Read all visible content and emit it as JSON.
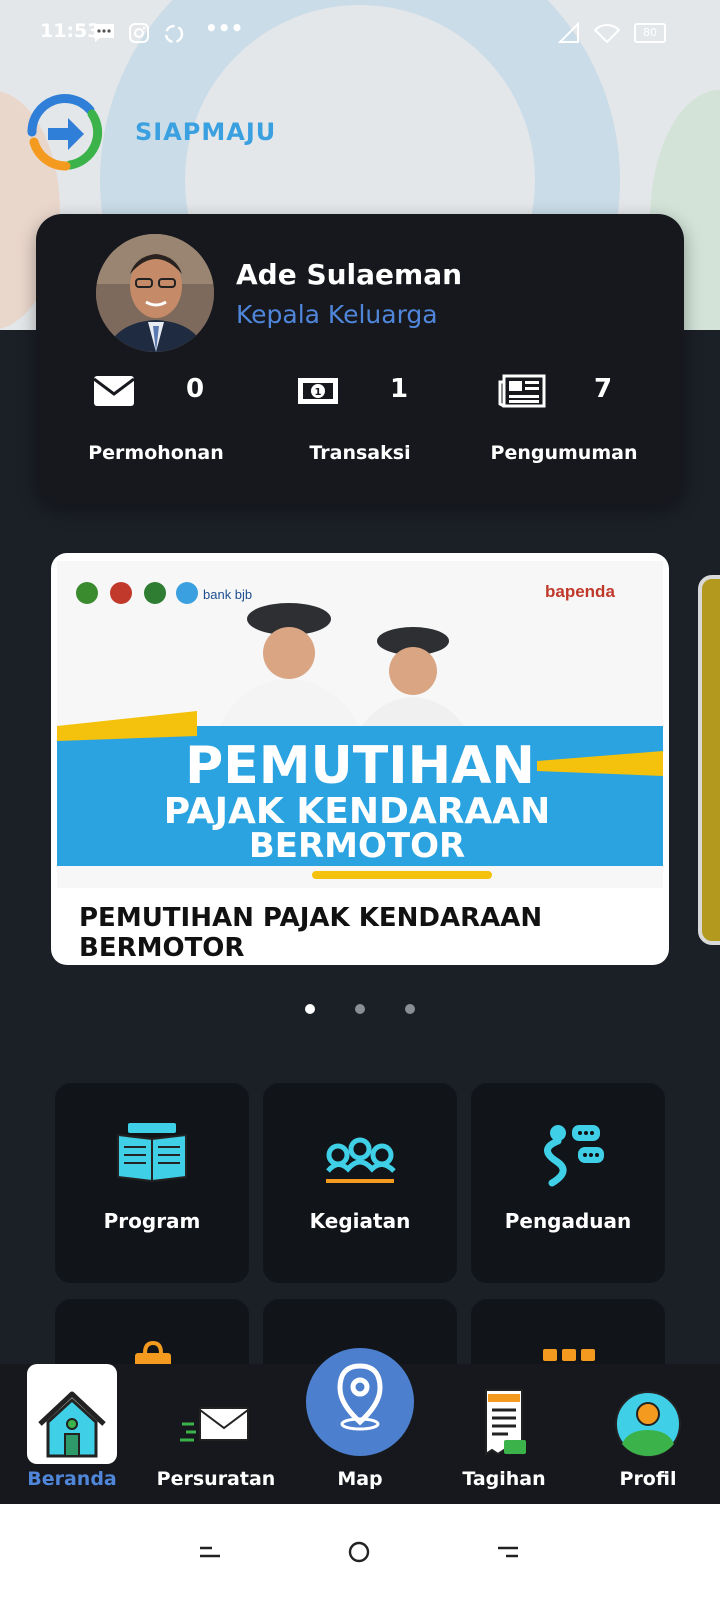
{
  "status_bar": {
    "time": "11:53",
    "more": "•••",
    "battery": "80"
  },
  "app": {
    "brand": "SIAPMAJU"
  },
  "profile": {
    "name": "Ade Sulaeman",
    "role": "Kepala Keluarga"
  },
  "stats": [
    {
      "icon": "mail-icon",
      "count": "0",
      "label": "Permohonan"
    },
    {
      "icon": "money-icon",
      "count": "1",
      "label": "Transaksi"
    },
    {
      "icon": "newspaper-icon",
      "count": "7",
      "label": "Pengumuman"
    }
  ],
  "banner": {
    "headline_line1": "PEMUTIHAN",
    "headline_line2": "PAJAK KENDARAAN",
    "headline_line3": "BERMOTOR",
    "partner": "bank bjb",
    "agency": "bapenda",
    "title": "PEMUTIHAN PAJAK KENDARAAN BERMOTOR"
  },
  "carousel": {
    "count": 3,
    "active": 0
  },
  "menu": [
    {
      "icon": "program-book-icon",
      "label": "Program"
    },
    {
      "icon": "kegiatan-people-icon",
      "label": "Kegiatan"
    },
    {
      "icon": "pengaduan-chat-icon",
      "label": "Pengaduan"
    }
  ],
  "bottom_nav": [
    {
      "icon": "home-icon",
      "label": "Beranda",
      "active": true
    },
    {
      "icon": "mail-send-icon",
      "label": "Persuratan"
    },
    {
      "icon": "map-pin-icon",
      "label": "Map"
    },
    {
      "icon": "invoice-icon",
      "label": "Tagihan"
    },
    {
      "icon": "user-icon",
      "label": "Profil"
    }
  ],
  "colors": {
    "background": "#1b1f26",
    "card": "#16181d",
    "accent": "#4f86d9",
    "brand": "#3aa0e0",
    "icon_cyan": "#3fd0e8"
  }
}
